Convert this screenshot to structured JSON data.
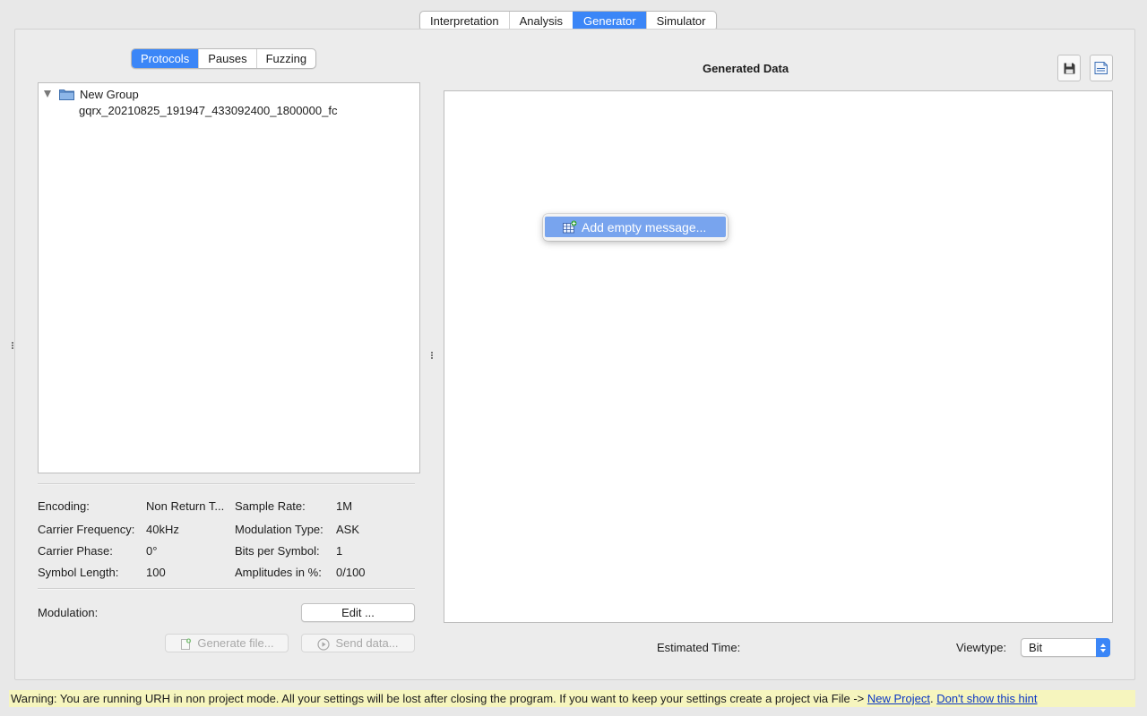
{
  "main_tabs": [
    {
      "label": "Interpretation",
      "active": false
    },
    {
      "label": "Analysis",
      "active": false
    },
    {
      "label": "Generator",
      "active": true
    },
    {
      "label": "Simulator",
      "active": false
    }
  ],
  "sub_tabs": [
    {
      "label": "Protocols",
      "active": true
    },
    {
      "label": "Pauses",
      "active": false
    },
    {
      "label": "Fuzzing",
      "active": false
    }
  ],
  "tree": {
    "group_name": "New Group",
    "items": [
      "gqrx_20210825_191947_433092400_1800000_fc"
    ]
  },
  "params": {
    "encoding_label": "Encoding:",
    "encoding_value": "Non Return T...",
    "sample_rate_label": "Sample Rate:",
    "sample_rate_value": "1M",
    "carrier_freq_label": "Carrier Frequency:",
    "carrier_freq_value": "40kHz",
    "modulation_type_label": "Modulation Type:",
    "modulation_type_value": "ASK",
    "carrier_phase_label": "Carrier Phase:",
    "carrier_phase_value": "0°",
    "bits_per_symbol_label": "Bits per Symbol:",
    "bits_per_symbol_value": "1",
    "symbol_length_label": "Symbol Length:",
    "symbol_length_value": "100",
    "amplitudes_label": "Amplitudes in %:",
    "amplitudes_value": "0/100"
  },
  "modulation": {
    "label": "Modulation:",
    "edit_button": "Edit ..."
  },
  "actions": {
    "generate_file": "Generate file...",
    "send_data": "Send data..."
  },
  "generated": {
    "title": "Generated Data",
    "context_menu_item": "Add empty message..."
  },
  "bottom": {
    "estimated_time_label": "Estimated Time:",
    "viewtype_label": "Viewtype:",
    "viewtype_value": "Bit"
  },
  "warning": {
    "text": "Warning: You are running URH in non project mode. All your settings will be lost after closing the program. If you want to keep your settings create a project via File -> ",
    "link_new_project": "New Project",
    "separator": ".",
    "link_dont_show": "Don't show this hint"
  },
  "colors": {
    "accent": "#3b86f7",
    "menu_highlight": "#78a4ee",
    "warning_bg": "#f6f5be",
    "link": "#0b36c4"
  }
}
